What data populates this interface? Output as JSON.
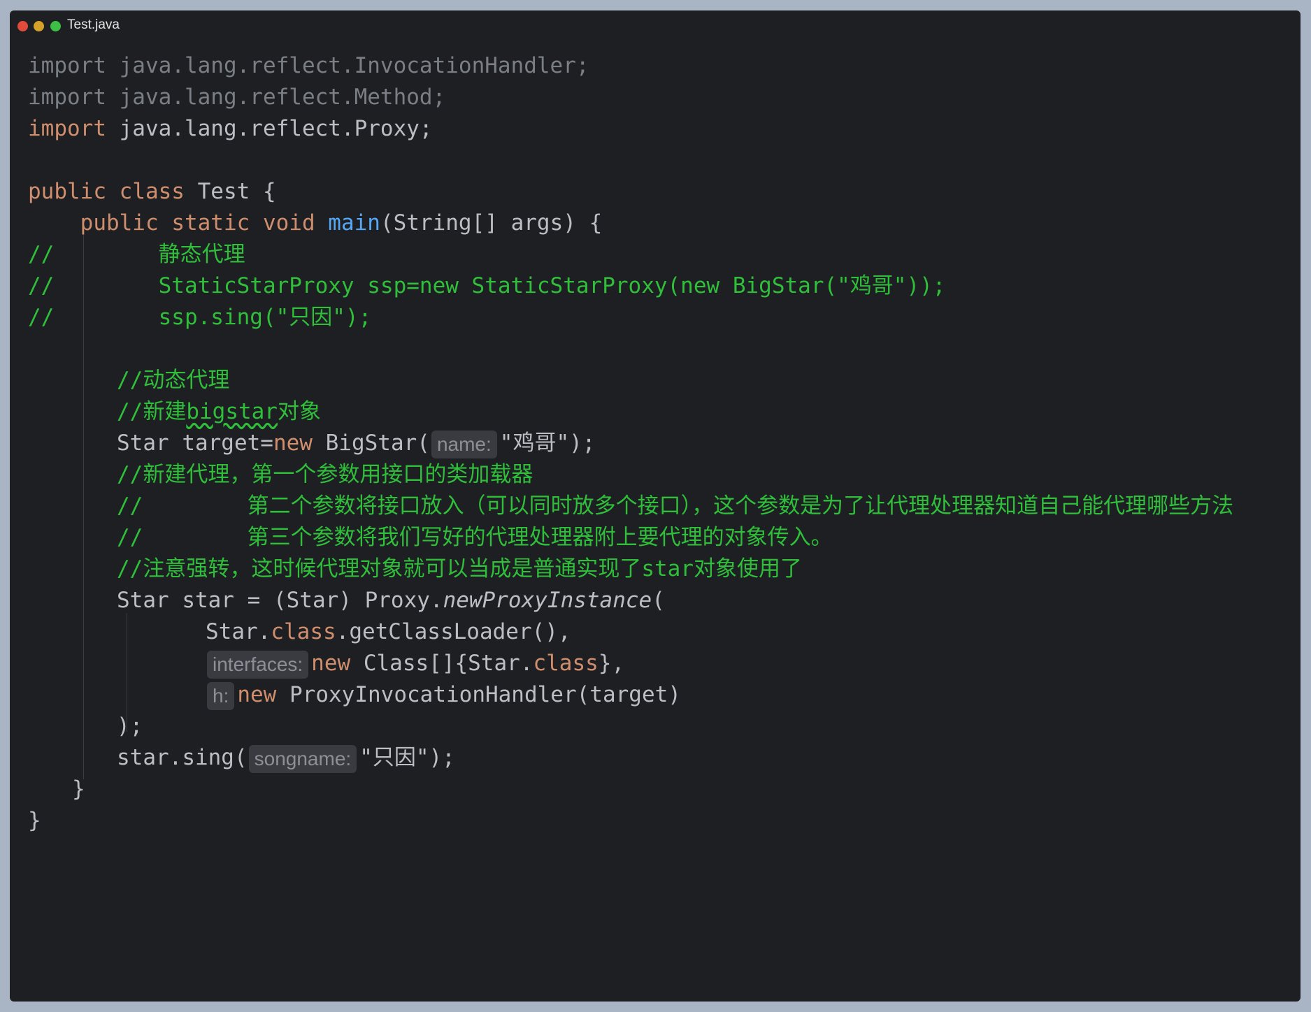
{
  "window": {
    "title": "Test.java"
  },
  "code": {
    "l1_kw": "import",
    "l1_rest": " java.lang.reflect.InvocationHandler;",
    "l2_kw": "import",
    "l2_rest": " java.lang.reflect.Method;",
    "l3_kw": "import",
    "l3_rest": " java.lang.reflect.Proxy;",
    "l5_public": "public",
    "l5_class": "class",
    "l5_rest": " Test {",
    "l6_public": "public",
    "l6_static": "static",
    "l6_void": "void",
    "l6_main": "main",
    "l6_rest": "(String[] args) {",
    "l7": "//        静态代理",
    "l8": "//        StaticStarProxy ssp=new StaticStarProxy(new BigStar(\"鸡哥\"));",
    "l9": "//        ssp.sing(\"只因\");",
    "l11": "//动态代理",
    "l12_a": "//新建",
    "l12_b": "bigstar",
    "l12_c": "对象",
    "l13_a": "Star target=",
    "l13_new": "new",
    "l13_b": " BigStar(",
    "l13_hint": "name:",
    "l13_c": "\"鸡哥\");",
    "l14": "//新建代理，第一个参数用接口的类加载器",
    "l15": "//        第二个参数将接口放入（可以同时放多个接口），这个参数是为了让代理处理器知道自己能代理哪些方法",
    "l16": "//        第三个参数将我们写好的代理处理器附上要代理的对象传入。",
    "l17": "//注意强转，这时候代理对象就可以当成是普通实现了star对象使用了",
    "l18_a": "Star star = (Star) Proxy.",
    "l18_b": "newProxyInstance",
    "l18_c": "(",
    "l19_a": "Star.",
    "l19_class": "class",
    "l19_b": ".getClassLoader(),",
    "l20_hint": "interfaces:",
    "l20_new": "new",
    "l20_a": " Class[]{Star.",
    "l20_class": "class",
    "l20_b": "},",
    "l21_hint": "h:",
    "l21_new": "new",
    "l21_a": " ProxyInvocationHandler(target)",
    "l22": ");",
    "l23_a": "star.sing(",
    "l23_hint": "songname:",
    "l23_b": "\"只因\");",
    "l24": "}",
    "l25": "}"
  },
  "colors": {
    "keyword": "#cf8e6d",
    "comment": "#2fbf3a",
    "method": "#56a8f5",
    "text": "#bcbec4",
    "background": "#1e1f22"
  }
}
